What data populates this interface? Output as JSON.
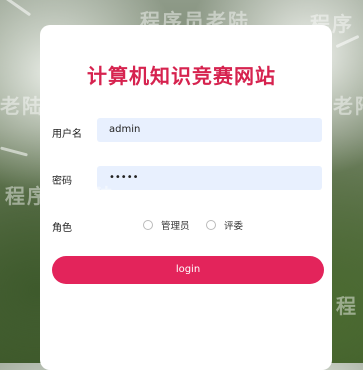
{
  "app": {
    "title": "计算机知识竞赛网站"
  },
  "form": {
    "username": {
      "label": "用户名",
      "value": "admin"
    },
    "password": {
      "label": "密码",
      "value": "•••••"
    },
    "role": {
      "label": "角色",
      "options": [
        {
          "label": "管理员",
          "selected": false
        },
        {
          "label": "评委",
          "selected": false
        }
      ]
    },
    "submit_label": "login"
  },
  "watermarks": [
    "程序员老陆",
    "老陆",
    "程序员老陆",
    "程序",
    "老陆",
    "程序员老陆",
    "程"
  ],
  "colors": {
    "title": "#d6234f",
    "button": "#e3245b",
    "input_bg": "#e8f0fe"
  }
}
